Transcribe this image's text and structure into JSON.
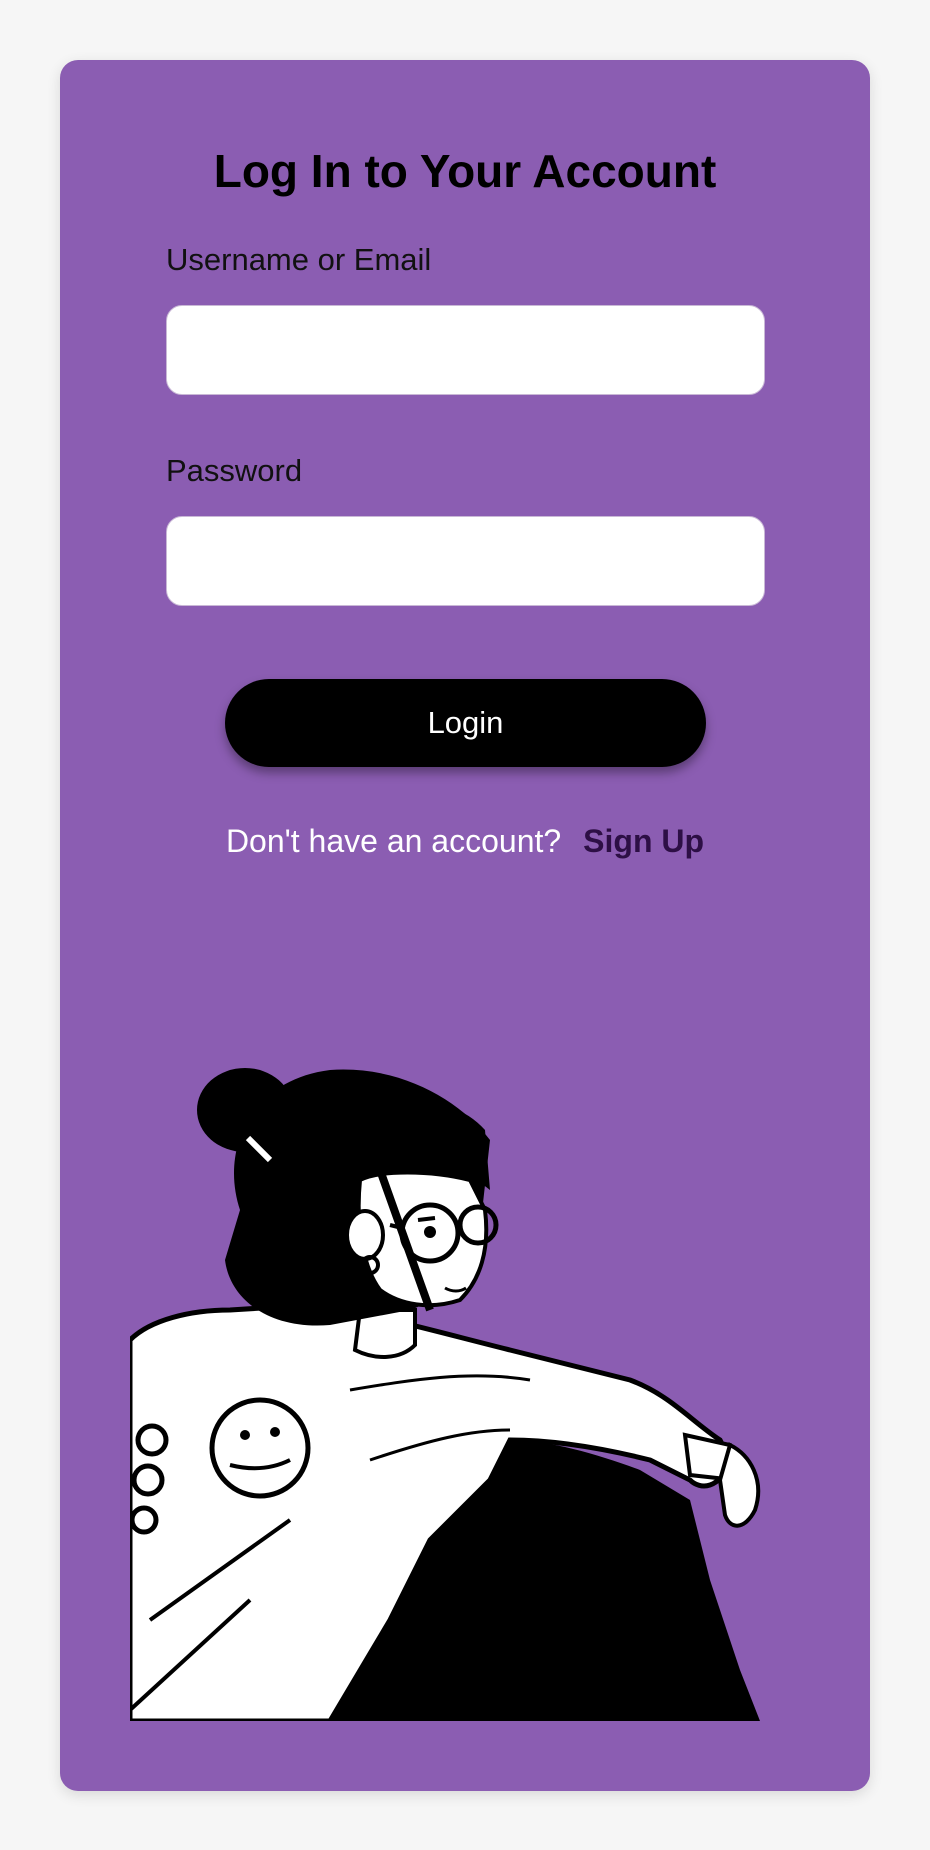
{
  "login": {
    "title": "Log In to Your Account",
    "username_label": "Username or Email",
    "username_value": "",
    "password_label": "Password",
    "password_value": "",
    "login_button": "Login",
    "signup_prompt": "Don't have an account?",
    "signup_link": "Sign Up"
  },
  "colors": {
    "page_bg": "#f6f6f6",
    "card_bg": "#8b5db2",
    "button_bg": "#000000",
    "link": "#2d0f45"
  },
  "illustration": {
    "icon": "girl-with-glasses-illustration"
  }
}
